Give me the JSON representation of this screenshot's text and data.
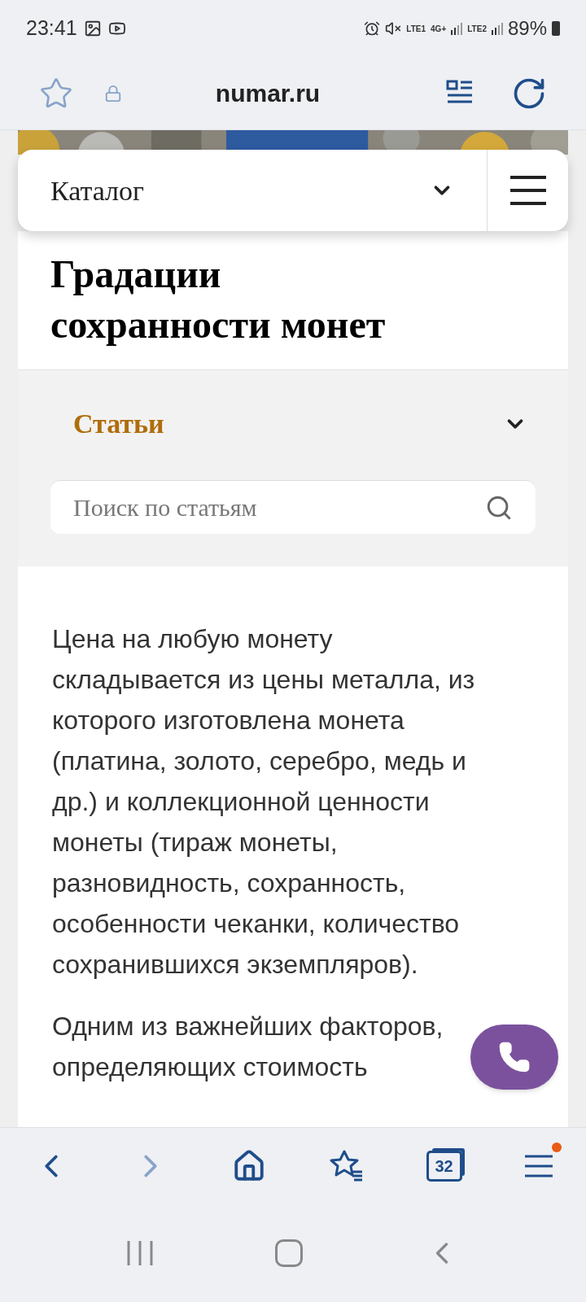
{
  "status_bar": {
    "time": "23:41",
    "sim1": "LTE1",
    "sim2": "LTE2",
    "network": "4G+",
    "battery": "89%"
  },
  "url_bar": {
    "url": "numar.ru"
  },
  "catalog_bar": {
    "label": "Каталог"
  },
  "title": "Градации сохранности монет",
  "section": {
    "label": "Статьи",
    "search_placeholder": "Поиск по статьям"
  },
  "paragraphs": [
    "Цена на любую монету складывается из цены металла, из которого изготовлена монета (платина, золото, серебро, медь и др.) и коллекционной ценности монеты (тираж монеты, разновидность, сохранность, особенности чеканки, количество сохранившихся экземпляров).",
    "Одним из важнейших факторов, определяющих стоимость"
  ],
  "bottom_nav": {
    "tab_count": "32",
    "menu_notification": true
  }
}
